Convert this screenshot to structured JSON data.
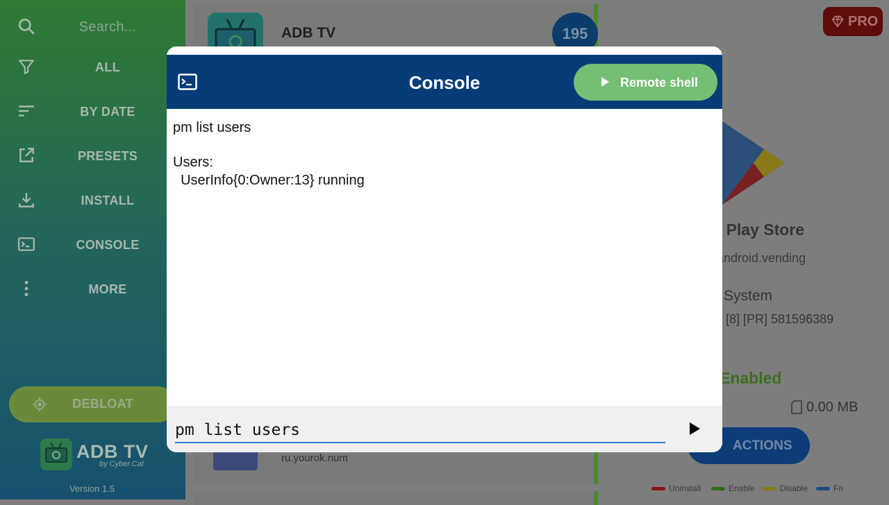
{
  "sidebar": {
    "search_placeholder": "Search...",
    "items": [
      {
        "label": "ALL",
        "icon": "filter-icon"
      },
      {
        "label": "BY DATE",
        "icon": "sort-icon"
      },
      {
        "label": "PRESETS",
        "icon": "external-link-icon"
      },
      {
        "label": "INSTALL",
        "icon": "download-icon"
      },
      {
        "label": "CONSOLE",
        "icon": "terminal-icon"
      },
      {
        "label": "MORE",
        "icon": "more-vertical-icon"
      }
    ],
    "debloat_label": "DEBLOAT",
    "logo_title": "ADB TV",
    "logo_subtitle": "by Cyber.Cat",
    "version": "Version 1.5"
  },
  "list": {
    "top_app_name": "ADB TV",
    "top_badge": "195",
    "bottom_app_package": "ru.yourok.num"
  },
  "details": {
    "pro_label": "PRO",
    "app_name_partial": "le Play Store",
    "package_partial": "android.vending",
    "type": "System",
    "version_line": "[8] [PR] 581596389",
    "status": "Enabled",
    "size": "0.00 MB",
    "actions_label": "ACTIONS",
    "legend": [
      {
        "label": "Uninstall",
        "color": "#8a1414"
      },
      {
        "label": "Enable",
        "color": "#2f6b1e"
      },
      {
        "label": "Disable",
        "color": "#8a7a10"
      },
      {
        "label": "Fn",
        "color": "#1b4a8a"
      }
    ]
  },
  "dialog": {
    "title": "Console",
    "remote_shell_label": "Remote shell",
    "output_lines": [
      "pm list users",
      "",
      "Users:",
      "  UserInfo{0:Owner:13} running"
    ],
    "input_value": "pm list users"
  },
  "colors": {
    "header_blue": "#073c78",
    "remote_green": "#75bf74",
    "input_underline": "#2f7ad8"
  }
}
